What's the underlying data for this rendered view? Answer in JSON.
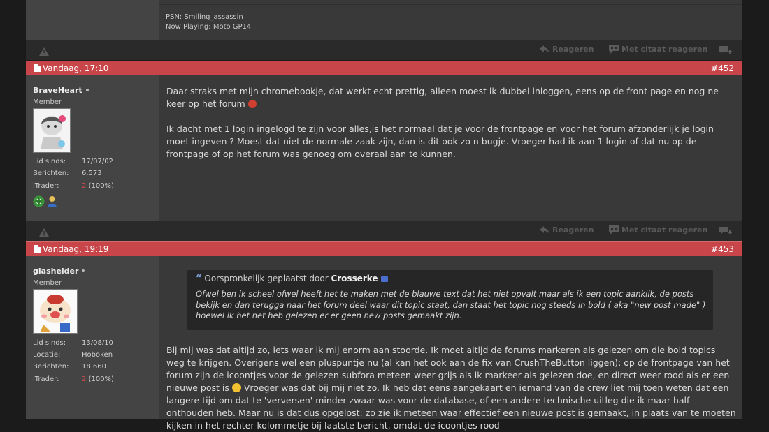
{
  "colors": {
    "post_header": "#c8464a",
    "sidebar": "#444444",
    "content": "#393939",
    "page": "#1b1b1b"
  },
  "top_post": {
    "signature": [
      "PSN: Smiling_assassin",
      "Now Playing: Moto GP14"
    ]
  },
  "actions": {
    "report_icon": "warning-triangle-icon",
    "reply_label": "Reageren",
    "quote_reply_label": "Met citaat reageren",
    "multiquote_icon": "multiquote-plus-icon"
  },
  "posts": [
    {
      "date": "Vandaag, 17:10",
      "number": "#452",
      "username": "BraveHeart",
      "role": "Member",
      "stats": [
        {
          "label": "Lid sinds:",
          "value": "17/07/02"
        },
        {
          "label": "Berichten:",
          "value": "6.573"
        },
        {
          "label": "iTrader:",
          "value_red": "2",
          "value": "(100%)"
        }
      ],
      "paragraphs": [
        "Daar straks met mijn chromebookje, dat werkt echt prettig, alleen moest ik dubbel inloggen, eens op de front page en nog ne keer op het forum",
        "Ik dacht met 1 login ingelogd te zijn voor alles,is het normaal dat je voor de frontpage en voor het forum afzonderlijk je login moet ingeven ? Moest dat niet de normale zaak zijn, dan is dit ook zo n bugje. Vroeger had ik aan 1 login of dat nu op de frontpage of op het forum was genoeg om overaal aan te kunnen."
      ]
    },
    {
      "date": "Vandaag, 19:19",
      "number": "#453",
      "username": "glashelder",
      "role": "Member",
      "stats": [
        {
          "label": "Lid sinds:",
          "value": "13/08/10"
        },
        {
          "label": "Locatie:",
          "value": "Hoboken"
        },
        {
          "label": "Berichten:",
          "value": "18.660"
        },
        {
          "label": "iTrader:",
          "value_red": "2",
          "value": "(100%)"
        }
      ],
      "quote": {
        "prefix": "Oorspronkelijk geplaatst door",
        "author": "Crosserke",
        "text": "Ofwel ben ik scheel ofwel heeft het te maken met de blauwe text dat het niet opvalt maar als ik een topic aanklik, de posts bekijk en dan terugga naar het forum deel waar dit topic staat, dan staat het topic nog steeds in bold ( aka \"new post made\" ) hoewel ik het net heb gelezen er er geen new posts gemaakt zijn."
      },
      "body_part1": "Bij mij was dat altijd zo, iets waar ik mij enorm aan stoorde. Ik moet altijd de forums markeren als gelezen om die bold topics weg te krijgen. Overigens wel een pluspuntje nu (al kan het ook aan de fix van CrushTheButton liggen): op de frontpage van het forum zijn de icoontjes voor de gelezen subfora meteen weer grijs als ik markeer als gelezen doe, en direct weer rood als er een nieuwe post is",
      "body_part2": " Vroeger was dat bij mij niet zo. Ik heb dat eens aangekaart en iemand van de crew liet mij toen weten dat een langere tijd om dat te 'verversen' minder zwaar was voor de database, of een andere technische uitleg die ik maar half onthouden heb. Maar nu is dat dus opgelost: zo zie ik meteen waar effectief een nieuwe post is gemaakt, in plaats van te moeten kijken in het rechter kolommetje bij laatste bericht, omdat de icoontjes rood"
    }
  ]
}
